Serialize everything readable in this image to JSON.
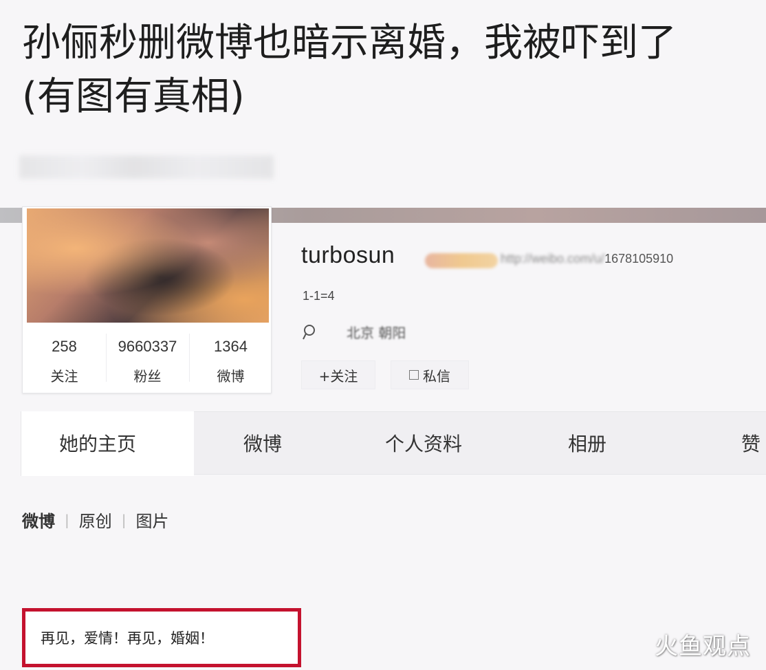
{
  "article": {
    "title": "孙俪秒删微博也暗示离婚，我被吓到了(有图有真相)"
  },
  "profile": {
    "username": "turbosun",
    "url": "http://weibo.com/u/1678105910",
    "url_blurred": "http://weibo.com/u/",
    "url_visible": "1678105910",
    "bio": "1-1=4",
    "location": "北京 朝阳",
    "stats": [
      {
        "value": "258",
        "label": "关注"
      },
      {
        "value": "9660337",
        "label": "粉丝"
      },
      {
        "value": "1364",
        "label": "微博"
      }
    ],
    "follow_label": "+关注",
    "message_label": "私信"
  },
  "tabs": [
    {
      "label": "她的主页"
    },
    {
      "label": "微博"
    },
    {
      "label": "个人资料"
    },
    {
      "label": "相册"
    },
    {
      "label": "赞"
    }
  ],
  "filters": [
    {
      "label": "微博"
    },
    {
      "label": "原创"
    },
    {
      "label": "图片"
    }
  ],
  "post": {
    "text": "再见，爱情！再见，婚姻！"
  },
  "watermark": "火鱼观点",
  "colors": {
    "highlight_border": "#c4122e",
    "background": "#f7f6f8"
  }
}
